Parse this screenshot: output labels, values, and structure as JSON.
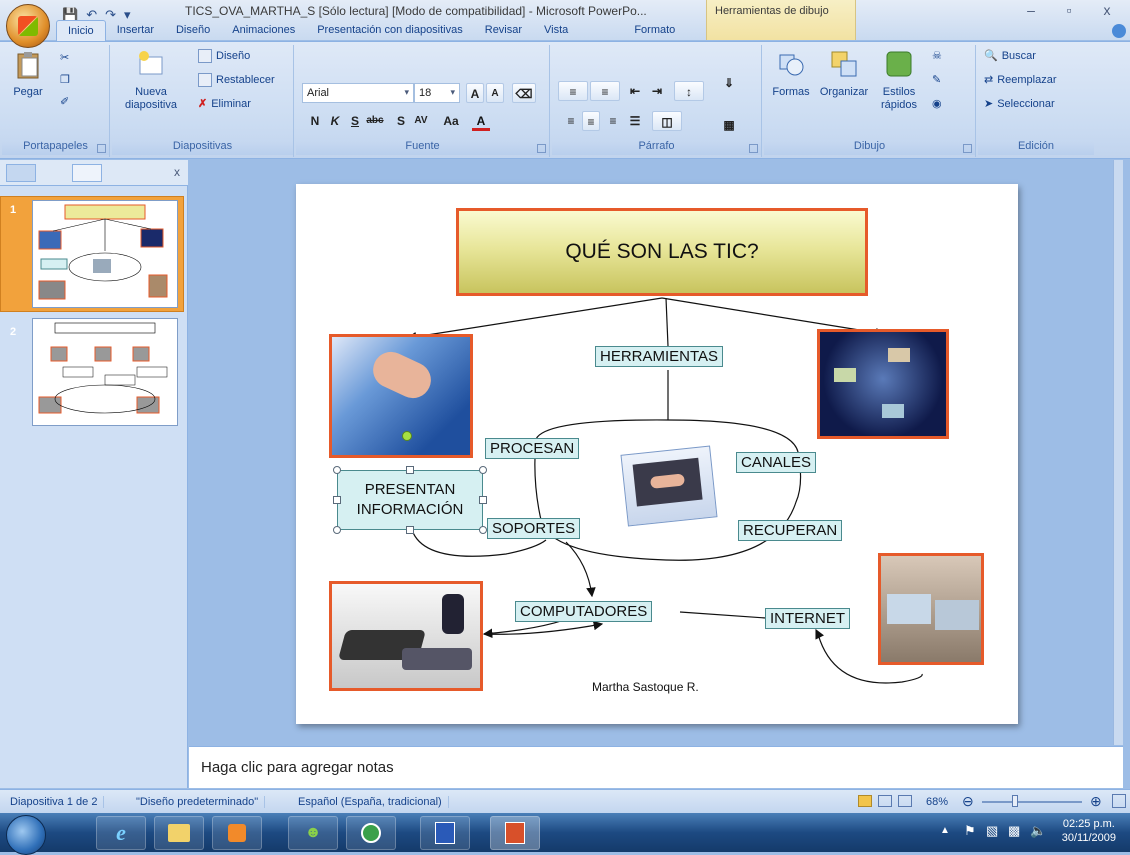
{
  "window": {
    "title": "TICS_OVA_MARTHA_S [Sólo lectura] [Modo de compatibilidad] - Microsoft PowerPo...",
    "contextual_group": "Herramientas de dibujo",
    "controls": [
      "–",
      "▫",
      "x"
    ]
  },
  "tabs": [
    "Inicio",
    "Insertar",
    "Diseño",
    "Animaciones",
    "Presentación con diapositivas",
    "Revisar",
    "Vista",
    "Formato"
  ],
  "ribbon": {
    "portapapeles": {
      "label": "Portapapeles",
      "paste": "Pegar"
    },
    "diapositivas": {
      "label": "Diapositivas",
      "new_slide_line1": "Nueva",
      "new_slide_line2": "diapositiva",
      "layout": "Diseño",
      "reset": "Restablecer",
      "delete": "Eliminar"
    },
    "fuente": {
      "label": "Fuente",
      "font_name": "Arial",
      "font_size": "18",
      "bold": "N",
      "italic": "K",
      "underline": "S",
      "strike": "abc",
      "shadow": "S",
      "spacing": "AV",
      "case": "Aa",
      "color": "A",
      "grow": "A",
      "shrink": "A"
    },
    "parrafo": {
      "label": "Párrafo"
    },
    "dibujo": {
      "label": "Dibujo",
      "shapes": "Formas",
      "arrange": "Organizar",
      "styles1": "Estilos",
      "styles2": "rápidos"
    },
    "edicion": {
      "label": "Edición",
      "find": "Buscar",
      "replace": "Reemplazar",
      "select": "Seleccionar"
    }
  },
  "slides_pane": {
    "close": "x",
    "slides": [
      {
        "number": "1"
      },
      {
        "number": "2"
      }
    ]
  },
  "slide": {
    "title": "QUÉ SON LAS TIC?",
    "nodes": {
      "herramientas": "HERRAMIENTAS",
      "procesan": "PROCESAN",
      "canales": "CANALES",
      "presentan_line1": "PRESENTAN",
      "presentan_line2": "INFORMACIÓN",
      "soportes": "SOPORTES",
      "recuperan": "RECUPERAN",
      "computadores": "COMPUTADORES",
      "internet": "INTERNET"
    },
    "author": "Martha Sastoque R."
  },
  "notes": {
    "placeholder": "Haga clic para agregar notas"
  },
  "status": {
    "slide_counter": "Diapositiva 1 de 2",
    "theme": "\"Diseño predeterminado\"",
    "language": "Español (España, tradicional)",
    "zoom": "68%"
  },
  "taskbar": {
    "time": "02:25 p.m.",
    "date": "30/11/2009"
  },
  "colors": {
    "accent_orange": "#e65a2a",
    "node_fill": "#d6f0f2",
    "ribbon_bg": "#dfe9f7",
    "workspace_bg": "#9dbde6"
  }
}
